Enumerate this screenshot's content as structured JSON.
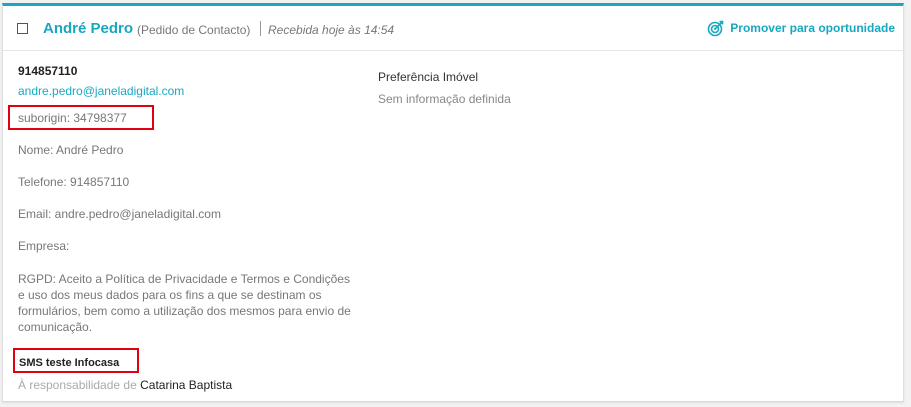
{
  "lead": {
    "name": "André Pedro",
    "type": "(Pedido de Contacto)",
    "received": "Recebida hoje às 14:54",
    "promote_label": "Promover para oportunidade",
    "phone": "914857110",
    "email": "andre.pedro@janeladigital.com",
    "suborigin": "suborigin: 34798377",
    "fields": {
      "nome": "Nome: André Pedro",
      "telefone": "Telefone: 914857110",
      "email": "Email: andre.pedro@janeladigital.com",
      "empresa": "Empresa:"
    },
    "rgpd": "RGPD: Aceito a Política de Privacidade e Termos e Condições e uso dos meus dados para os fins a que se destinam os formulários, bem como a utilização dos mesmos para envio de comunicação.",
    "source": "SMS teste Infocasa",
    "responsibility_prefix": "À responsabilidade de",
    "responsible": "Catarina Baptista"
  },
  "preferences": {
    "title": "Preferência Imóvel",
    "value": "Sem informação definida"
  },
  "colors": {
    "accent": "#17a8c0",
    "highlight": "#e0000f"
  }
}
